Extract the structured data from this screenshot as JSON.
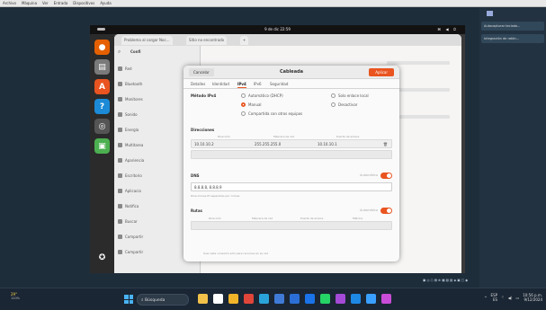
{
  "host_menubar": {
    "items": [
      "Archivo",
      "Máquina",
      "Ver",
      "Entrada",
      "Dispositivos",
      "Ayuda"
    ]
  },
  "ubuntu_topbar": {
    "clock": "9 de dic 22:59",
    "tray": "⌘ ◀ ⏻"
  },
  "dock": {
    "apps": [
      {
        "name": "firefox",
        "color": "#e66000",
        "glyph": "●"
      },
      {
        "name": "files",
        "color": "#7a7a7a",
        "glyph": "▤"
      },
      {
        "name": "software",
        "color": "#e95420",
        "glyph": "A"
      },
      {
        "name": "help",
        "color": "#1c8ad6",
        "glyph": "?"
      },
      {
        "name": "settings",
        "color": "#555555",
        "glyph": "◎"
      },
      {
        "name": "terminal",
        "color": "#4caf50",
        "glyph": "▣"
      },
      {
        "name": "ubuntu-logo",
        "color": "#2b2b2b",
        "glyph": "✪"
      }
    ]
  },
  "browser_tabs": [
    {
      "label": "Problema al cargar Noc..."
    },
    {
      "label": "Sitio no encontrado"
    },
    {
      "label": "+"
    }
  ],
  "settings_sidebar": {
    "title": "Confi",
    "items": [
      "Red",
      "Bluetooth",
      "Monitores",
      "Sonido",
      "Energía",
      "Multitarea",
      "Apariencia",
      "Escritorio",
      "Aplicacio",
      "Notifica",
      "Buscar",
      "Compartir",
      "Compartir"
    ]
  },
  "dialog": {
    "cancel_label": "Cancelar",
    "title": "Cableada",
    "apply_label": "Aplicar",
    "tabs": [
      "Detalles",
      "Identidad",
      "IPv4",
      "IPv6",
      "Seguridad"
    ],
    "active_tab": "IPv4",
    "method_label": "Método IPv4",
    "methods": [
      {
        "label": "Automático (DHCP)",
        "selected": false
      },
      {
        "label": "Solo enlace local",
        "selected": false
      },
      {
        "label": "Manual",
        "selected": true
      },
      {
        "label": "Desactivar",
        "selected": false
      },
      {
        "label": "Compartida con otros equipos",
        "selected": false
      }
    ],
    "addresses": {
      "label": "Direcciones",
      "columns": [
        "Dirección",
        "Máscara de red",
        "Puerta de enlace"
      ],
      "rows": [
        {
          "address": "10.10.10.2",
          "netmask": "255.255.255.0",
          "gateway": "10.10.10.1"
        }
      ]
    },
    "dns": {
      "label": "DNS",
      "auto_label": "Automático",
      "value": "8.8.8.8, 8.8.8.9",
      "helper": "Direcciones IP separadas por comas"
    },
    "routes": {
      "label": "Rutas",
      "auto_label": "Automático",
      "columns": [
        "Dirección",
        "Máscara de red",
        "Puerta de enlace",
        "Métrica"
      ],
      "footer": "Usar esta conexión sólo para recursos en su red"
    }
  },
  "host_right_panel": {
    "items": [
      "Autocapturar teclado...",
      "Integración de ratón..."
    ]
  },
  "taskbar": {
    "weather_temp": "29°",
    "weather_note": "120%",
    "search_placeholder": "Búsqueda",
    "lang": "ESP",
    "lang_sub": "ES",
    "clock_time": "10:56 p.m.",
    "clock_date": "9/12/2024",
    "apps": [
      {
        "name": "files-app",
        "color": "#f2c14a"
      },
      {
        "name": "store-app",
        "color": "#ffffff"
      },
      {
        "name": "folder-app",
        "color": "#f0b429"
      },
      {
        "name": "chrome-app",
        "color": "#e0453a"
      },
      {
        "name": "edge-app",
        "color": "#2aa4d8"
      },
      {
        "name": "photos-app",
        "color": "#3f7bd6"
      },
      {
        "name": "mail-app",
        "color": "#2b6fd6"
      },
      {
        "name": "outlook-app",
        "color": "#1a73e8"
      },
      {
        "name": "whatsapp-app",
        "color": "#25d366"
      },
      {
        "name": "paint-app",
        "color": "#a44ad6"
      },
      {
        "name": "vbox-app",
        "color": "#1e88e5"
      },
      {
        "name": "vscode-app",
        "color": "#3aa0ff"
      },
      {
        "name": "extra-app",
        "color": "#c94cd6"
      }
    ]
  }
}
